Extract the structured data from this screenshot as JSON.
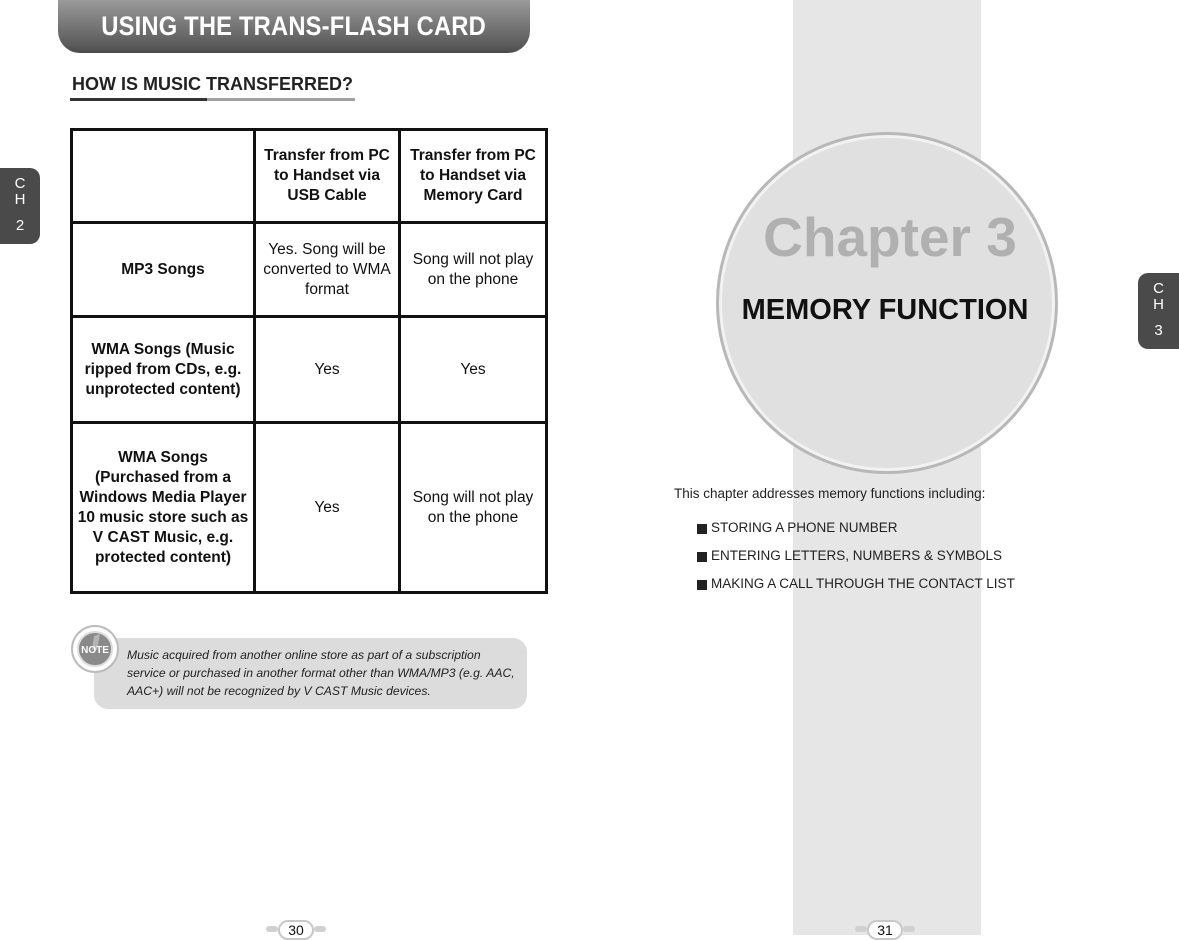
{
  "left_page": {
    "header": "USING THE TRANS-FLASH CARD",
    "section_title": "HOW IS MUSIC TRANSFERRED?",
    "chapter_tab": {
      "letters": [
        "C",
        "H"
      ],
      "number": "2"
    },
    "table": {
      "headers": [
        "",
        "Transfer from PC to Handset via USB Cable",
        "Transfer from PC to Handset via Memory Card"
      ],
      "rows": [
        {
          "label": "MP3 Songs",
          "usb": "Yes. Song will be converted to WMA format",
          "card": "Song will not play on the phone"
        },
        {
          "label": "WMA Songs (Music ripped from CDs, e.g. unprotected content)",
          "usb": "Yes",
          "card": "Yes"
        },
        {
          "label": "WMA Songs (Purchased from a Windows Media Player 10 music store such as V CAST Music, e.g. protected content)",
          "usb": "Yes",
          "card": "Song will not play on the phone"
        }
      ]
    },
    "note": {
      "icon_label": "NOTE",
      "text": "Music acquired from another online store as part of a subscription service or purchased in another format other than WMA/MP3 (e.g. AAC, AAC+) will not be recognized by V CAST Music devices."
    },
    "page_number": "30"
  },
  "right_page": {
    "chapter_label": "Chapter 3",
    "chapter_title": "MEMORY FUNCTION",
    "chapter_tab": {
      "letters": [
        "C",
        "H"
      ],
      "number": "3"
    },
    "intro": "This chapter addresses memory functions including:",
    "bullets": [
      "STORING A PHONE NUMBER",
      "ENTERING LETTERS, NUMBERS & SYMBOLS",
      "MAKING A CALL THROUGH THE CONTACT LIST"
    ],
    "page_number": "31"
  }
}
